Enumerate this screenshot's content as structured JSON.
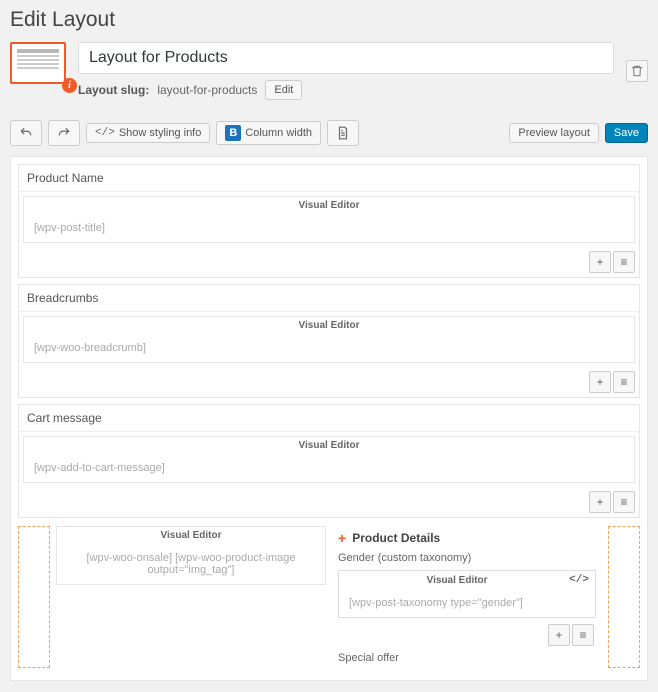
{
  "page_title": "Edit Layout",
  "title_input": "Layout for Products",
  "slug": {
    "label": "Layout slug:",
    "value": "layout-for-products",
    "edit_btn": "Edit"
  },
  "toolbar": {
    "styling": "Show styling info",
    "column_width": "Column width",
    "preview": "Preview layout",
    "save": "Save"
  },
  "blocks": {
    "product_name": {
      "title": "Product Name",
      "cell_label": "Visual Editor",
      "content": "[wpv-post-title]"
    },
    "breadcrumbs": {
      "title": "Breadcrumbs",
      "cell_label": "Visual Editor",
      "content": "[wpv-woo-breadcrumb]"
    },
    "cart_message": {
      "title": "Cart message",
      "cell_label": "Visual Editor",
      "content": "[wpv-add-to-cart-message]"
    }
  },
  "row2": {
    "left": {
      "cell_label": "Visual Editor",
      "content": "[wpv-woo-onsale] [wpv-woo-product-image output=\"img_tag\"]"
    },
    "right": {
      "header": "Product Details",
      "gender_label": "Gender (custom taxonomy)",
      "gender": {
        "cell_label": "Visual Editor",
        "content": "[wpv-post-taxonomy type=\"gender\"]"
      },
      "special_offer": "Special offer"
    }
  },
  "icons": {
    "plus": "+",
    "list": "≡",
    "code": "</>"
  }
}
